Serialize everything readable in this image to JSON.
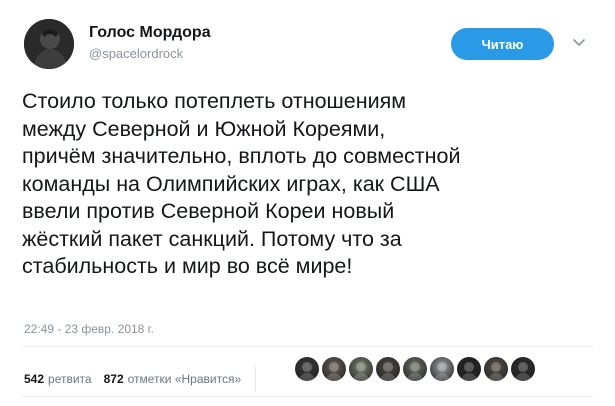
{
  "author": {
    "display_name": "Голос Мордора",
    "handle": "@spacelordrock"
  },
  "follow_button": {
    "label": "Читаю",
    "color": "#2b9ae6"
  },
  "tweet": {
    "text": "Стоило только потеплеть отношениям\nмежду Северной и Южной Кореями,\nпричём значительно, вплоть до совместной\nкоманды на Олимпийских играх, как США\nввели против Северной Кореи новый\nжёсткий пакет санкций. Потому что за\nстабильность и мир во всё мире!",
    "timestamp": "22:49 - 23 февр. 2018 г."
  },
  "stats": {
    "retweets_count": "542",
    "retweets_label": "ретвита",
    "likes_count": "872",
    "likes_label": "отметки «Нравится»"
  },
  "likers": [
    {
      "icon": "avatar-icon",
      "color": "#3a3a3a"
    },
    {
      "icon": "avatar-icon",
      "color": "#6b6055"
    },
    {
      "icon": "avatar-icon",
      "color": "#7b8570"
    },
    {
      "icon": "avatar-icon",
      "color": "#4e4a45"
    },
    {
      "icon": "avatar-icon",
      "color": "#6f7568"
    },
    {
      "icon": "avatar-icon",
      "color": "#9aa0a6"
    },
    {
      "icon": "avatar-icon",
      "color": "#252525"
    },
    {
      "icon": "avatar-icon",
      "color": "#5a5048"
    },
    {
      "icon": "avatar-icon",
      "color": "#2d2d2d"
    }
  ]
}
